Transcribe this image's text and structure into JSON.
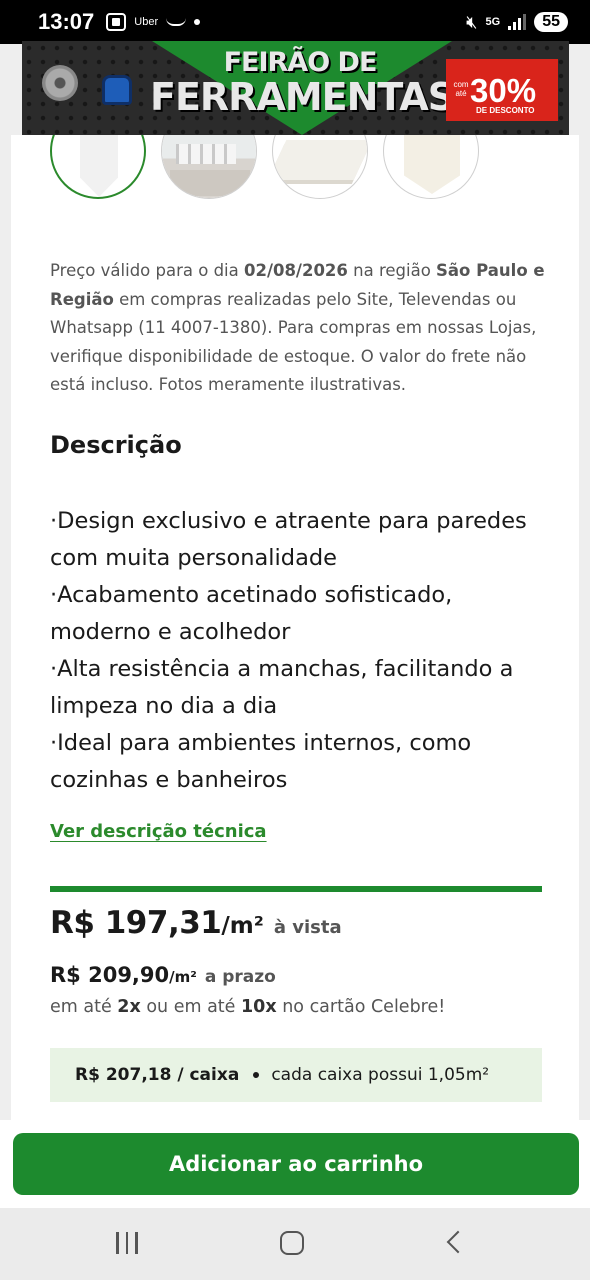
{
  "status_bar": {
    "time": "13:07",
    "uber_label": "Uber",
    "network": "5G",
    "battery": "55"
  },
  "promo": {
    "title_line1": "FEIRÃO DE",
    "title_line2": "FERRAMENTAS",
    "discount_prefix": "com até",
    "discount_value": "30%",
    "discount_label": "DE DESCONTO"
  },
  "price_note": {
    "part1": "Preço válido para o dia ",
    "date": "02/08/2026",
    "part2": " na região ",
    "region": "São Paulo e Região",
    "part3": " em compras realizadas pelo Site, Televendas ou Whatsapp (11 4007-1380). Para compras em nossas Lojas, verifique disponibilidade de estoque. O valor do frete não está incluso. Fotos meramente ilustrativas."
  },
  "description": {
    "title": "Descrição",
    "items": [
      "·Design exclusivo e atraente para paredes com muita personalidade",
      "·Acabamento acetinado sofisticado, moderno e acolhedor",
      "·Alta resistência a manchas, facilitando a limpeza no dia a dia",
      "·Ideal para ambientes internos, como cozinhas e banheiros"
    ],
    "tech_link": "Ver descrição técnica"
  },
  "pricing": {
    "cash_value": "R$ 197,31",
    "cash_unit": "/m²",
    "cash_suffix": "à vista",
    "term_value": "R$ 209,90",
    "term_unit": "/m²",
    "term_suffix": "a prazo",
    "installments_pre": "em até ",
    "installments_2x": "2x",
    "installments_mid": " ou em até ",
    "installments_10x": "10x",
    "installments_post": " no cartão Celebre!",
    "box_price": "R$ 207,18 / caixa",
    "box_info": "cada caixa possui 1,05m²"
  },
  "cart": {
    "button_label": "Adicionar ao carrinho"
  },
  "colors": {
    "brand_green": "#1d8a2e",
    "light_green": "#e8f3e4",
    "promo_red": "#d9241b"
  }
}
